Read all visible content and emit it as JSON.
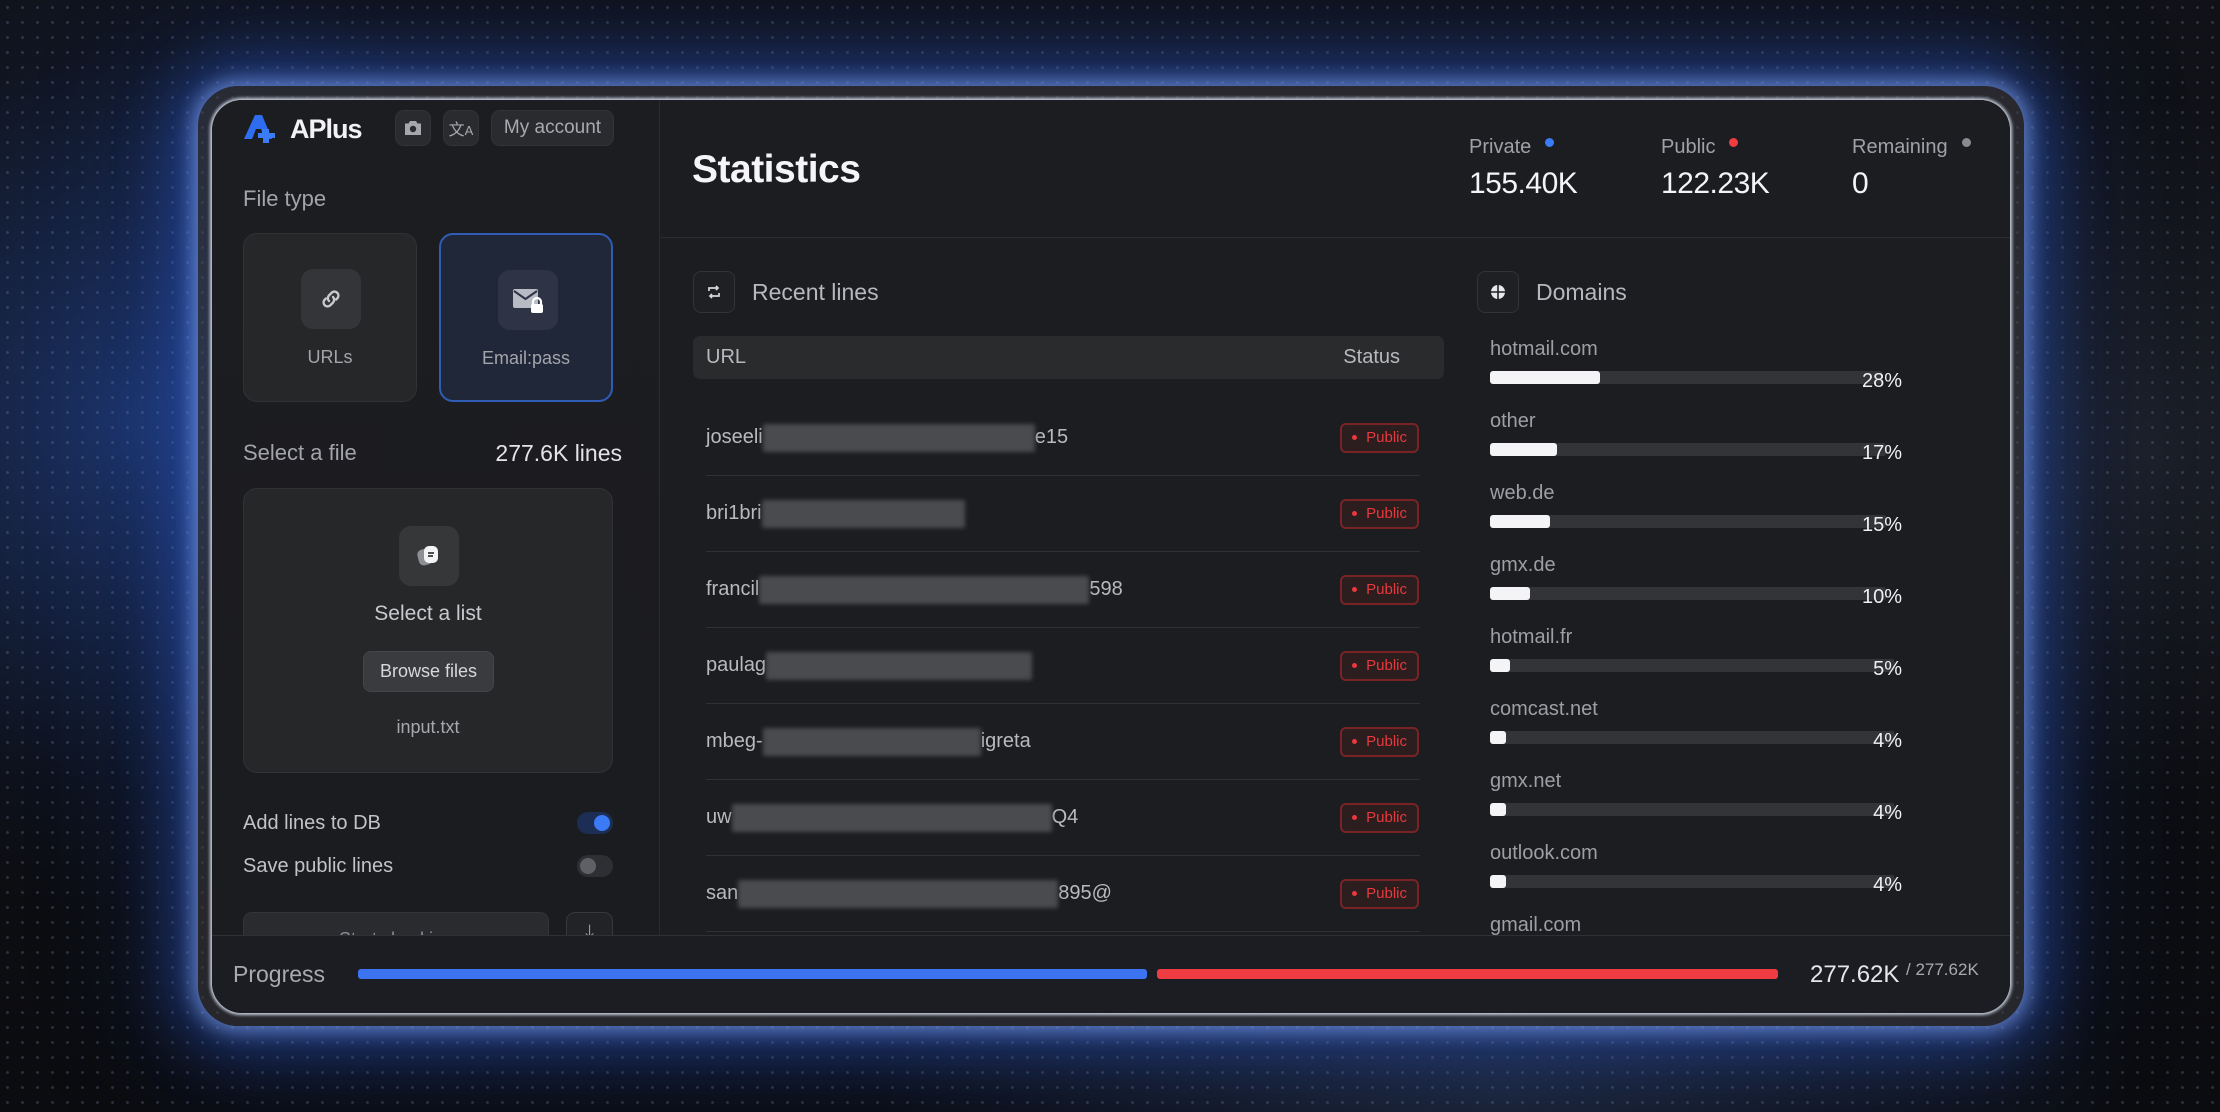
{
  "app": {
    "name": "APlus",
    "header_buttons": {
      "screenshot_icon": "camera-icon",
      "language_icon": "translate-icon",
      "account_label": "My account"
    }
  },
  "sidebar": {
    "file_type_label": "File type",
    "file_types": [
      {
        "label": "URLs",
        "icon": "link-icon",
        "selected": false
      },
      {
        "label": "Email:pass",
        "icon": "mail-lock-icon",
        "selected": true
      }
    ],
    "select_file_label": "Select a file",
    "lines_count": "277.6K lines",
    "dropzone": {
      "title": "Select a list",
      "browse_label": "Browse files",
      "filename": "input.txt"
    },
    "toggles": [
      {
        "label": "Add lines to DB",
        "on": true
      },
      {
        "label": "Save public lines",
        "on": false
      }
    ],
    "start_label": "Start checking",
    "download_icon": "download-icon"
  },
  "main": {
    "title": "Statistics",
    "stats": [
      {
        "label": "Private",
        "value": "155.40K",
        "color": "#3b7bf6"
      },
      {
        "label": "Public",
        "value": "122.23K",
        "color": "#ef3b42"
      },
      {
        "label": "Remaining",
        "value": "0",
        "color": "#8a8b90"
      }
    ],
    "recent": {
      "title": "Recent lines",
      "columns": [
        "URL",
        "Status"
      ],
      "rows": [
        {
          "prefix": "joseeli",
          "suffix": "e15",
          "status": "Public"
        },
        {
          "prefix": "bri1bri",
          "suffix": "",
          "status": "Public"
        },
        {
          "prefix": "francil",
          "suffix": "598",
          "status": "Public"
        },
        {
          "prefix": "paulag",
          "suffix": "",
          "status": "Public"
        },
        {
          "prefix": "mbeg-",
          "suffix": "igreta",
          "status": "Public"
        },
        {
          "prefix": "uw",
          "suffix": "Q4",
          "status": "Public"
        },
        {
          "prefix": "san",
          "suffix": "895@",
          "status": "Public"
        }
      ]
    },
    "domains": {
      "title": "Domains",
      "items": [
        {
          "name": "hotmail.com",
          "percent": 28,
          "label": "28%"
        },
        {
          "name": "other",
          "percent": 17,
          "label": "17%"
        },
        {
          "name": "web.de",
          "percent": 15,
          "label": "15%"
        },
        {
          "name": "gmx.de",
          "percent": 10,
          "label": "10%"
        },
        {
          "name": "hotmail.fr",
          "percent": 5,
          "label": "5%"
        },
        {
          "name": "comcast.net",
          "percent": 4,
          "label": "4%"
        },
        {
          "name": "gmx.net",
          "percent": 4,
          "label": "4%"
        },
        {
          "name": "outlook.com",
          "percent": 4,
          "label": "4%"
        },
        {
          "name": "gmail.com",
          "percent": null,
          "label": ""
        }
      ]
    }
  },
  "footer": {
    "label": "Progress",
    "private_count": 155.4,
    "public_count": 122.23,
    "done": "277.62K",
    "total": "/ 277.62K",
    "colors": {
      "private": "#3b73f0",
      "public": "#ef3b42"
    }
  }
}
